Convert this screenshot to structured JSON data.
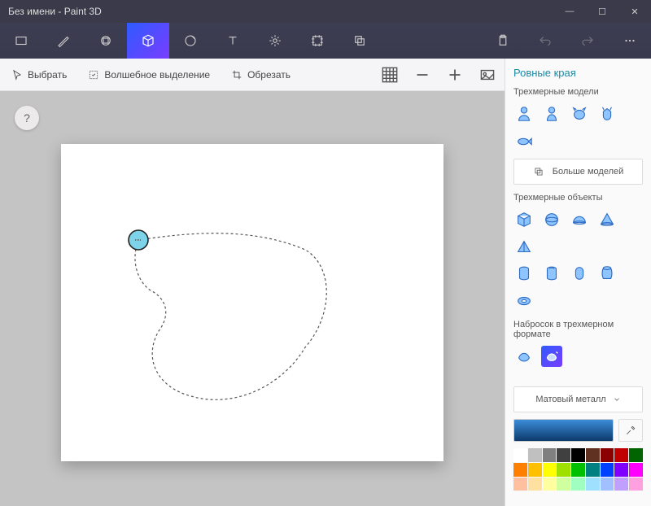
{
  "window": {
    "title": "Без имени - Paint 3D",
    "minimize": "—",
    "maximize": "☐",
    "close": "✕"
  },
  "subbar": {
    "select": "Выбрать",
    "magic": "Волшебное выделение",
    "crop": "Обрезать"
  },
  "help": "?",
  "side": {
    "title": "Ровные края",
    "models_heading": "Трехмерные модели",
    "more_models": "Больше моделей",
    "objects_heading": "Трехмерные объекты",
    "sketch_heading": "Набросок в трехмерном формате",
    "material": "Матовый металл"
  },
  "palette": [
    "#ffffff",
    "#c0c0c0",
    "#808080",
    "#404040",
    "#000000",
    "#603020",
    "#8b0000",
    "#c00000",
    "#006400",
    "#ff8000",
    "#ffc000",
    "#ffff00",
    "#a0e000",
    "#00c000",
    "#008080",
    "#0040ff",
    "#8000ff",
    "#ff00ff",
    "#ffc0a0",
    "#ffe0a0",
    "#ffffa0",
    "#d0ffa0",
    "#a0ffc0",
    "#a0e0ff",
    "#a0c0ff",
    "#c0a0ff",
    "#ffa0e0"
  ]
}
